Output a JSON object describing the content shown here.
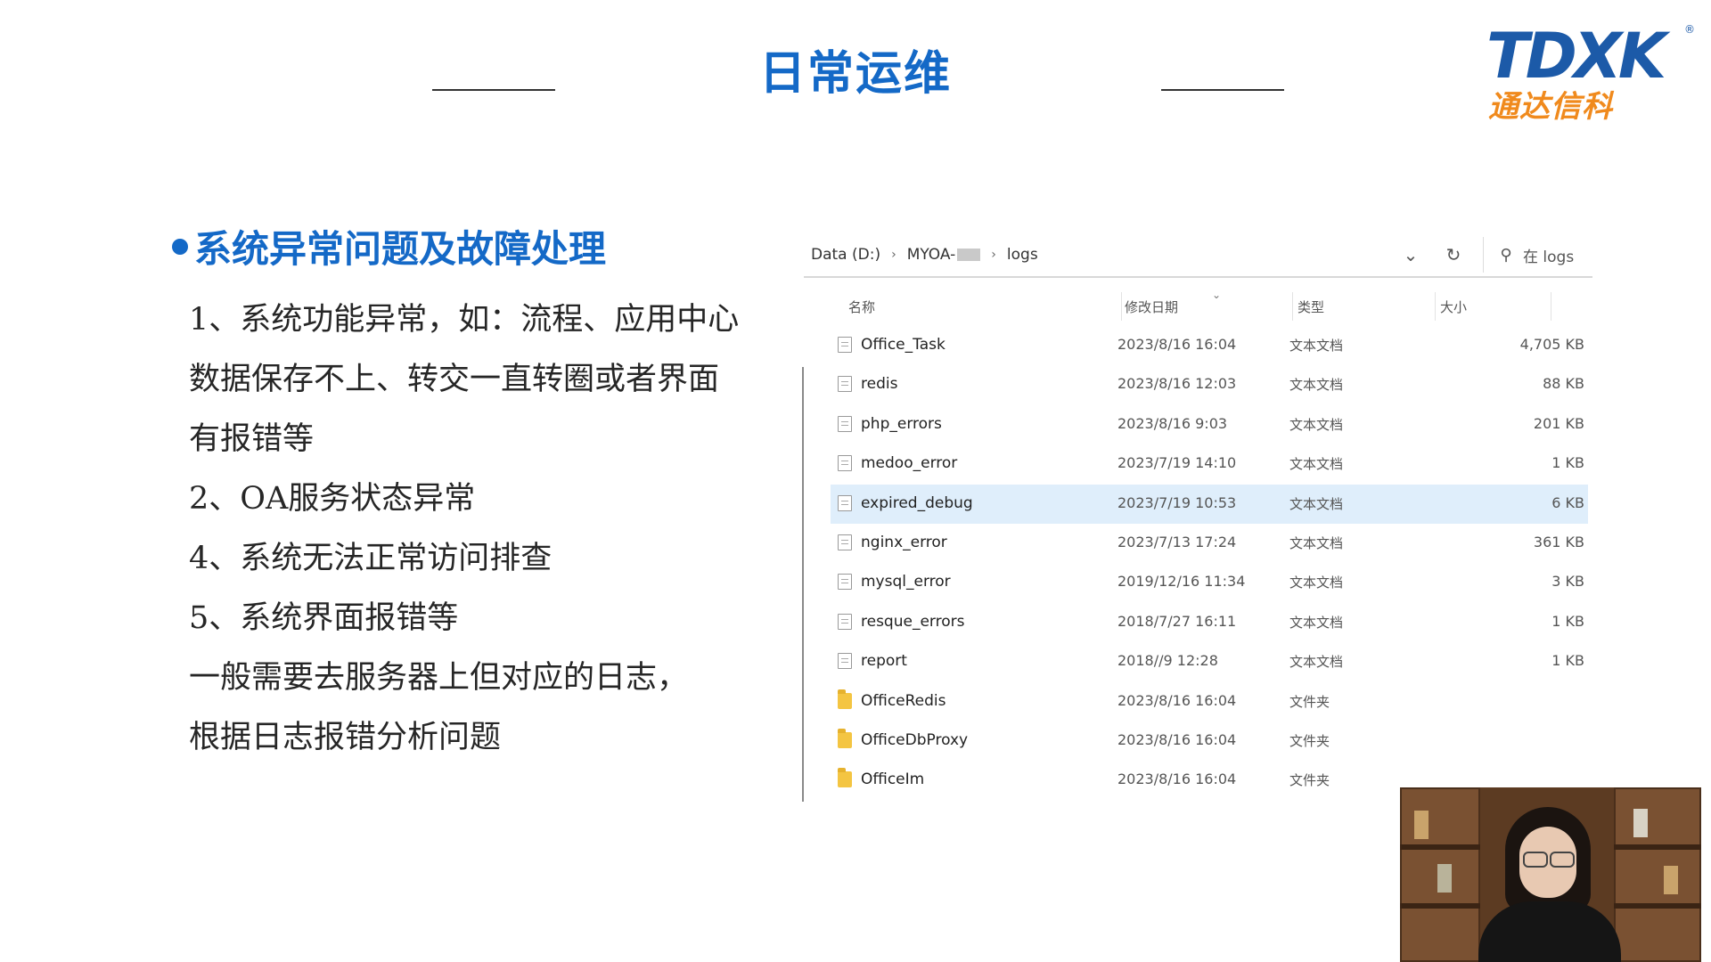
{
  "slide": {
    "title": "日常运维",
    "logo_text": "TDXK",
    "logo_registered": "®",
    "logo_sub": "通达信科",
    "section_heading": "系统异常问题及故障处理",
    "body_lines": [
      "1、系统功能异常，如：流程、应用中心",
      "数据保存不上、转交一直转圈或者界面",
      "有报错等",
      "2、OA服务状态异常",
      "4、系统无法正常访问排查",
      "5、系统界面报错等",
      "一般需要去服务器上但对应的日志，",
      "根据日志报错分析问题"
    ]
  },
  "explorer": {
    "breadcrumb": [
      "Data (D:)",
      "MYOA-",
      "logs"
    ],
    "search_placeholder": "在 logs",
    "columns": {
      "name": "名称",
      "date": "修改日期",
      "type": "类型",
      "size": "大小"
    },
    "rows": [
      {
        "name": "Office_Task",
        "date": "2023/8/16 16:04",
        "type": "文本文档",
        "size": "4,705 KB",
        "kind": "file"
      },
      {
        "name": "redis",
        "date": "2023/8/16 12:03",
        "type": "文本文档",
        "size": "88 KB",
        "kind": "file"
      },
      {
        "name": "php_errors",
        "date": "2023/8/16 9:03",
        "type": "文本文档",
        "size": "201 KB",
        "kind": "file"
      },
      {
        "name": "medoo_error",
        "date": "2023/7/19 14:10",
        "type": "文本文档",
        "size": "1 KB",
        "kind": "file"
      },
      {
        "name": "expired_debug",
        "date": "2023/7/19 10:53",
        "type": "文本文档",
        "size": "6 KB",
        "kind": "file",
        "selected": true
      },
      {
        "name": "nginx_error",
        "date": "2023/7/13 17:24",
        "type": "文本文档",
        "size": "361 KB",
        "kind": "file"
      },
      {
        "name": "mysql_error",
        "date": "2019/12/16 11:34",
        "type": "文本文档",
        "size": "3 KB",
        "kind": "file"
      },
      {
        "name": "resque_errors",
        "date": "2018/7/27 16:11",
        "type": "文本文档",
        "size": "1 KB",
        "kind": "file"
      },
      {
        "name": "report",
        "date": "2018//9 12:28",
        "type": "文本文档",
        "size": "1 KB",
        "kind": "file"
      },
      {
        "name": "OfficeRedis",
        "date": "2023/8/16 16:04",
        "type": "文件夹",
        "size": "",
        "kind": "folder"
      },
      {
        "name": "OfficeDbProxy",
        "date": "2023/8/16 16:04",
        "type": "文件夹",
        "size": "",
        "kind": "folder"
      },
      {
        "name": "OfficeIm",
        "date": "2023/8/16 16:04",
        "type": "文件夹",
        "size": "",
        "kind": "folder"
      }
    ],
    "icons": {
      "dropdown": "chevron-down-icon",
      "refresh": "refresh-icon",
      "search": "search-icon",
      "sort": "sort-arrow-icon"
    }
  },
  "colors": {
    "accent": "#1469c7",
    "logo_blue": "#1c5aa8",
    "logo_orange": "#f08a1d",
    "selected_row": "#dfeefb"
  }
}
